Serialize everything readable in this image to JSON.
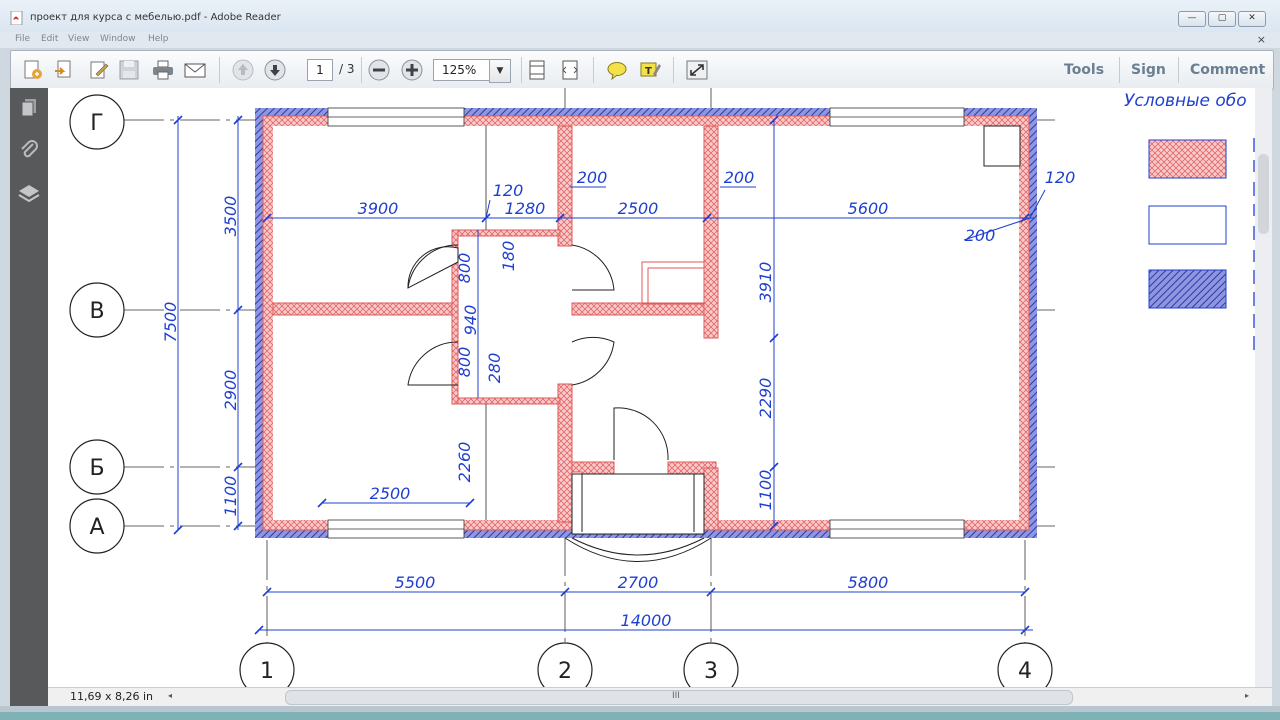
{
  "window": {
    "title": "проект для курса с мебелью.pdf - Adobe Reader",
    "min": "—",
    "max": "▢",
    "close": "✕"
  },
  "menu": {
    "items": [
      "File",
      "Edit",
      "View",
      "Window",
      "Help"
    ],
    "close": "×"
  },
  "toolbar": {
    "page_current": "1",
    "page_total": "/ 3",
    "zoom": "125%",
    "zoom_caret": "▼",
    "tools": "Tools",
    "sign": "Sign",
    "comment": "Comment",
    "icons": [
      "create-pdf-icon",
      "open-icon",
      "edit-icon",
      "save-icon",
      "print-icon",
      "email-icon",
      "page-up-icon",
      "page-down-icon",
      "zoom-out-icon",
      "zoom-in-icon",
      "fit-page-icon",
      "fit-width-icon",
      "comment-icon",
      "highlight-icon",
      "fullscreen-icon"
    ]
  },
  "drawing": {
    "axis_rows": [
      "Г",
      "В",
      "Б",
      "А"
    ],
    "axis_cols": [
      "1",
      "2",
      "3",
      "4"
    ],
    "dims_top": [
      "3900",
      "1280",
      "2500",
      "5600"
    ],
    "dims_small": [
      "120",
      "200",
      "200",
      "120",
      "200"
    ],
    "dims_left_chain": [
      "3500",
      "2900",
      "1100"
    ],
    "dim_left_total": "7500",
    "dims_right": [
      "3910",
      "2290",
      "1100"
    ],
    "dims_stair": [
      "800",
      "180",
      "940",
      "800",
      "280",
      "2260"
    ],
    "dim_inner_bottom": "2500",
    "dims_bottom": [
      "5500",
      "2700",
      "5800"
    ],
    "dim_total": "14000",
    "legend_title": "Условные обо"
  },
  "status": {
    "page_size": "11,69 x 8,26 in",
    "scroll_left": "◂",
    "scroll_right": "▸",
    "grip": "III"
  },
  "colors": {
    "dimension": "#1f3fd1",
    "wall_hatch": "#e05a5a",
    "wall_hatch_fill": "#f7c9c9",
    "outer_wall": "#2c3aa8"
  }
}
